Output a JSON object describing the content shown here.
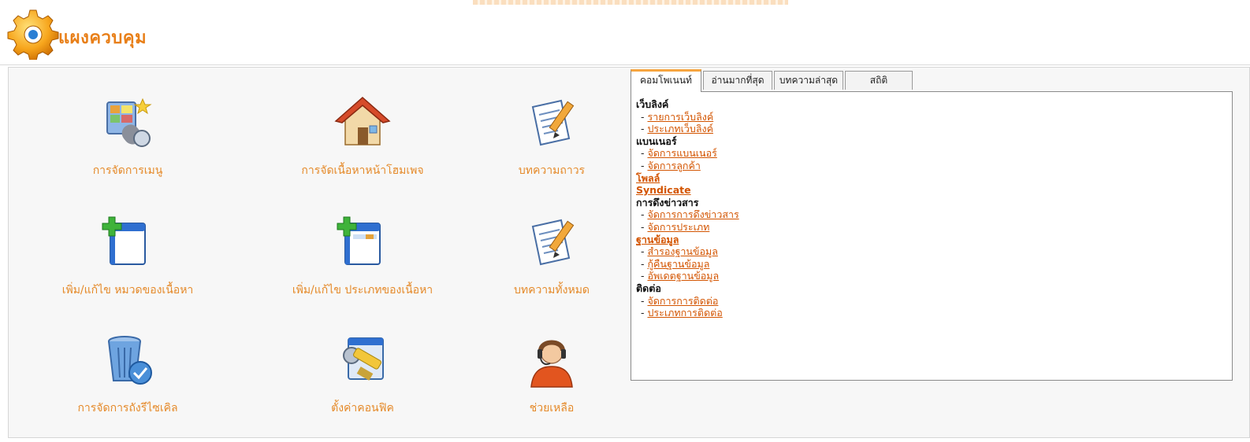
{
  "header": {
    "title": "แผงควบคุม",
    "icon": "gear-icon"
  },
  "colors": {
    "accent": "#e87f18",
    "link": "#d35400",
    "tab_active": "#f7a540"
  },
  "tiles": [
    {
      "label": "การจัดการเมนู",
      "icon": "menu-manager-icon"
    },
    {
      "label": "การจัดเนื้อหาหน้าโฮมเพจ",
      "icon": "home-icon"
    },
    {
      "label": "บทความถาวร",
      "icon": "article-edit-icon"
    },
    {
      "label": "เพิ่ม/แก้ไข หมวดของเนื้อหา",
      "icon": "add-window-icon"
    },
    {
      "label": "เพิ่ม/แก้ไข ประเภทของเนื้อหา",
      "icon": "add-window-type-icon"
    },
    {
      "label": "บทความทั้งหมด",
      "icon": "articles-all-icon"
    },
    {
      "label": "การจัดการถังรีไซเคิล",
      "icon": "recycle-bin-icon"
    },
    {
      "label": "ตั้งค่าคอนฟิค",
      "icon": "config-tools-icon"
    },
    {
      "label": "ช่วยเหลือ",
      "icon": "help-support-icon"
    }
  ],
  "tabs": [
    {
      "label": "คอมโพเนนท์",
      "active": true
    },
    {
      "label": "อ่านมากที่สุด",
      "active": false
    },
    {
      "label": "บทความล่าสุด",
      "active": false
    },
    {
      "label": "สถิติ",
      "active": false
    }
  ],
  "components": [
    {
      "title": "เว็บลิงค์",
      "is_link": false,
      "items": [
        "รายการเว็บลิงค์",
        "ประเภทเว็บลิงค์"
      ]
    },
    {
      "title": "แบนเนอร์",
      "is_link": false,
      "items": [
        "จัดการแบนเนอร์",
        "จัดการลูกค้า"
      ]
    },
    {
      "title": "โพลล์",
      "is_link": true,
      "items": []
    },
    {
      "title": "Syndicate",
      "is_link": true,
      "items": []
    },
    {
      "title": "การดึงข่าวสาร",
      "is_link": false,
      "items": [
        "จัดการการดึงข่าวสาร",
        "จัดการประเภท"
      ]
    },
    {
      "title": "ฐานข้อมูล",
      "is_link": true,
      "items": [
        "สำรองฐานข้อมูล",
        "กู้คืนฐานข้อมูล",
        "อัพเดตฐานข้อมูล"
      ]
    },
    {
      "title": "ติดต่อ",
      "is_link": false,
      "items": [
        "จัดการการติดต่อ",
        "ประเภทการติดต่อ"
      ]
    }
  ]
}
